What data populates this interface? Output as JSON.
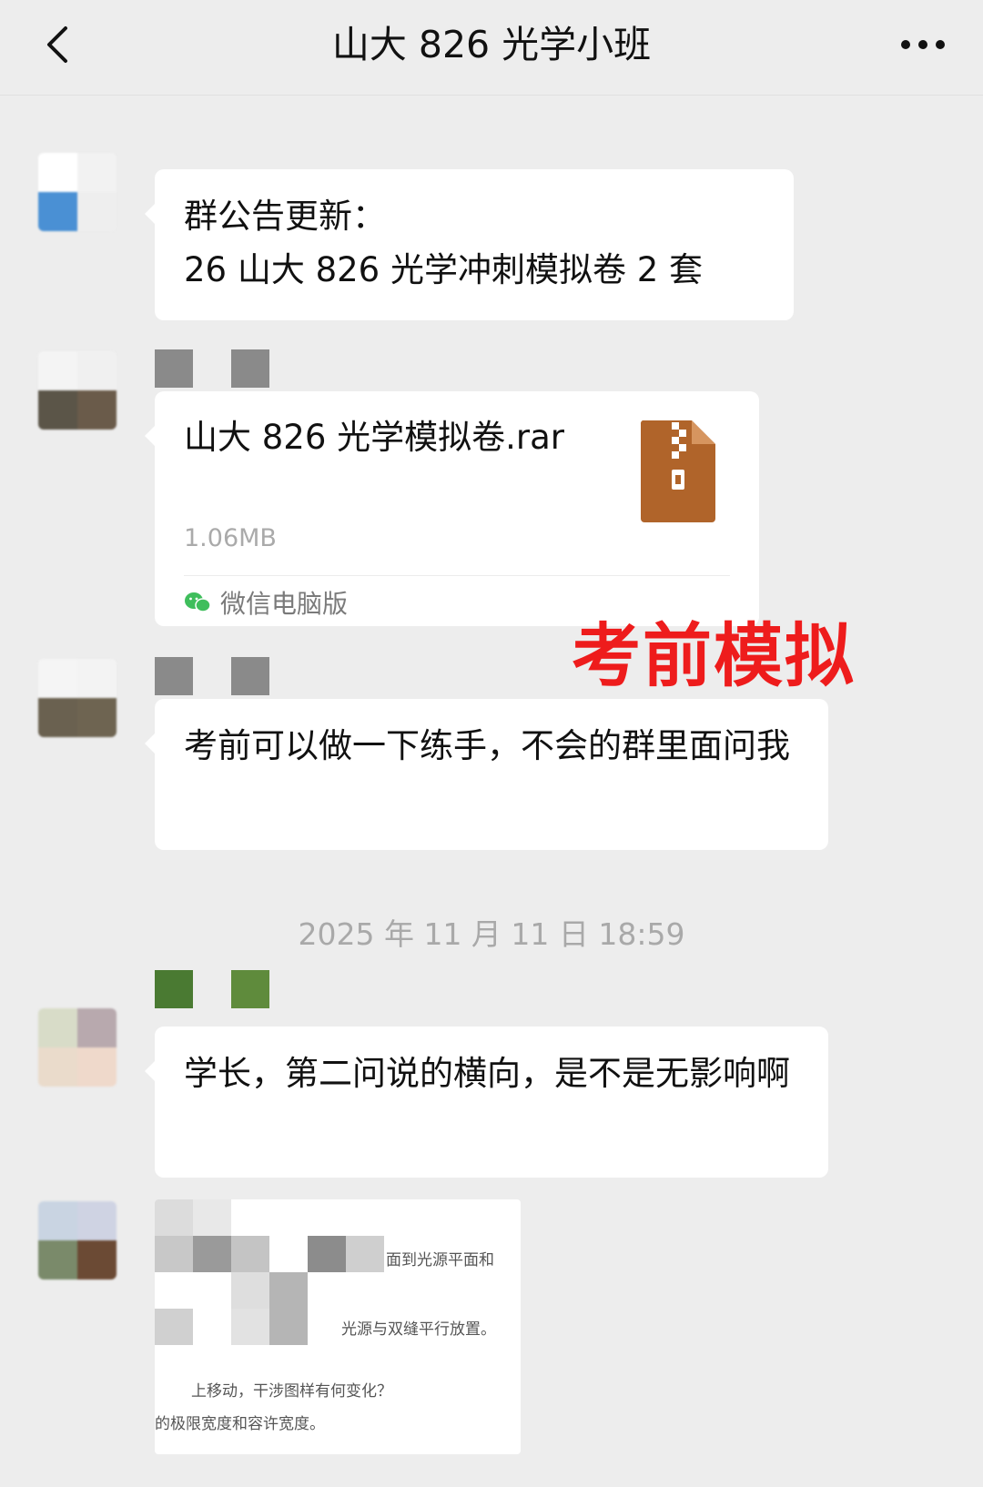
{
  "header": {
    "title": "山大 826 光学小班",
    "back_icon": "chevron-left-icon",
    "more_icon": "more-dots-icon"
  },
  "messages": [
    {
      "type": "text",
      "text_line1": "群公告更新：",
      "text_line2": "26 山大 826 光学冲刺模拟卷 2 套"
    },
    {
      "type": "file",
      "file_name": "山大 826 光学模拟卷.rar",
      "file_size": "1.06MB",
      "source": "微信电脑版",
      "file_icon": "rar-archive-icon"
    },
    {
      "type": "text",
      "text": "考前可以做一下练手，不会的群里面问我"
    },
    {
      "type": "text",
      "text": "学长，第二问说的横向，是不是无影响啊"
    },
    {
      "type": "image",
      "lines": [
        "面到光源平面和",
        "光源与双缝平行放置。",
        "上移动，干涉图样有何变化？",
        "的极限宽度和容许宽度。"
      ]
    }
  ],
  "overlay_label": "考前模拟",
  "timestamp": "2025 年 11 月 11 日 18:59",
  "colors": {
    "background": "#ededed",
    "bubble": "#ffffff",
    "overlay_red": "#ee1c1c",
    "file_icon": "#b0642a",
    "wechat_green": "#3fbe5c"
  }
}
